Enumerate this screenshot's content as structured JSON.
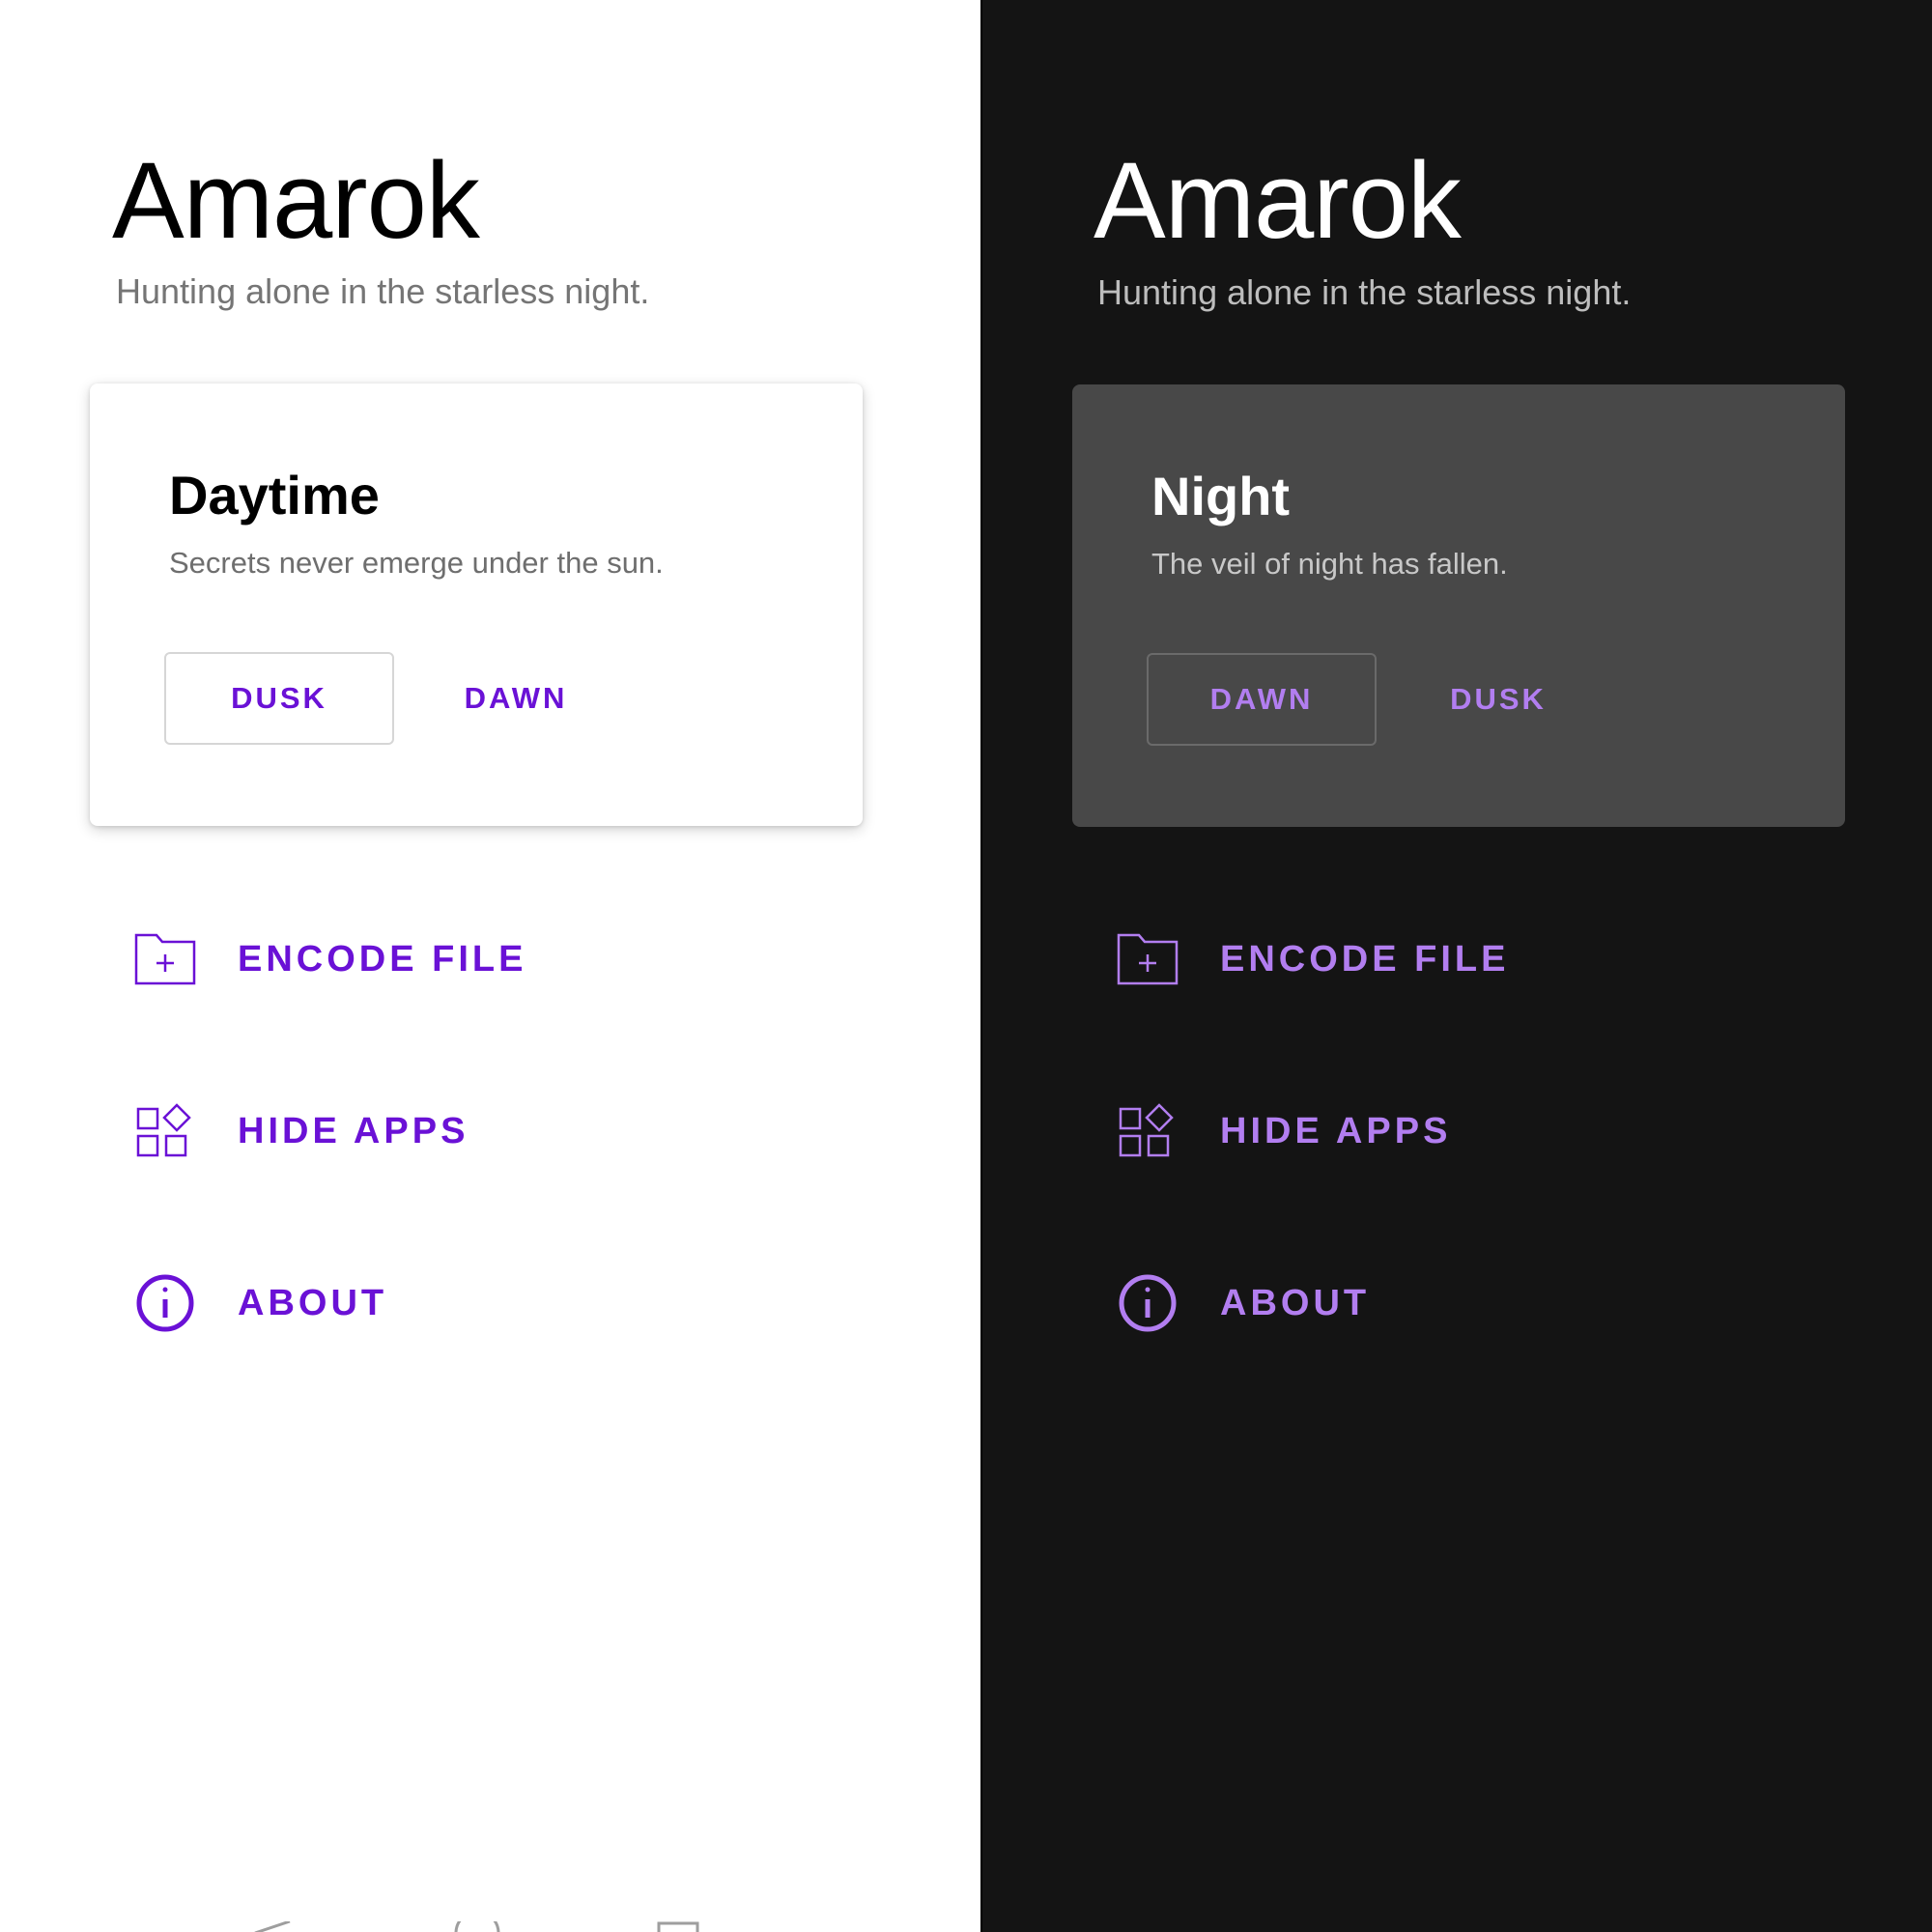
{
  "light": {
    "app_title": "Amarok",
    "app_subtitle": "Hunting alone in the starless night.",
    "card": {
      "title": "Daytime",
      "subtitle": "Secrets never emerge under the sun.",
      "outlined_button": "DUSK",
      "text_button": "DAWN"
    },
    "menu": [
      {
        "label": "ENCODE FILE",
        "icon": "folder-add-icon"
      },
      {
        "label": "HIDE APPS",
        "icon": "apps-grid-icon"
      },
      {
        "label": "ABOUT",
        "icon": "info-icon"
      }
    ],
    "accent_color": "#6a11d6",
    "background": "#ffffff"
  },
  "dark": {
    "app_title": "Amarok",
    "app_subtitle": "Hunting alone in the starless night.",
    "card": {
      "title": "Night",
      "subtitle": "The veil of night has fallen.",
      "outlined_button": "DAWN",
      "text_button": "DUSK"
    },
    "menu": [
      {
        "label": "ENCODE FILE",
        "icon": "folder-add-icon"
      },
      {
        "label": "HIDE APPS",
        "icon": "apps-grid-icon"
      },
      {
        "label": "ABOUT",
        "icon": "info-icon"
      }
    ],
    "accent_color": "#b27ef0",
    "background": "#141414"
  },
  "navigation_bar": {
    "icons": [
      "back-icon",
      "home-icon",
      "recents-icon"
    ]
  }
}
